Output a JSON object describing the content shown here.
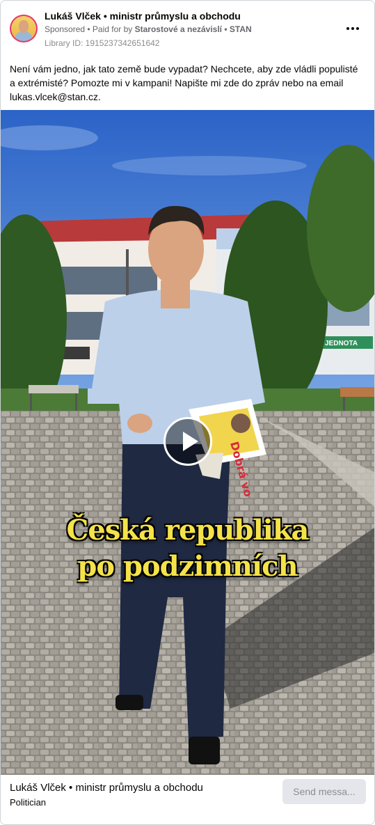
{
  "header": {
    "page_name": "Lukáš Vlček • ministr průmyslu a obchodu",
    "sponsored_label": "Sponsored",
    "paid_for_prefix": " • Paid for by ",
    "paid_for_entity": "Starostové a nezávislí • STAN",
    "library_id": "Library ID: 1915237342651642",
    "more_icon": "more-horizontal-icon"
  },
  "post": {
    "text": "Není vám jedno, jak tato země bude vypadat? Nechcete, aby zde vládli populisté a extrémisté? Pomozte mi v kampani! Napište mi zde do zpráv nebo na email lukas.vlcek@stan.cz."
  },
  "video": {
    "caption_line1": "Česká republika",
    "caption_line2": "po podzimních",
    "play_icon": "play-icon",
    "newspaper_headline": "Dobrá vo",
    "shop_sign": "JEDNOTA"
  },
  "footer": {
    "title": "Lukáš Vlček • ministr průmyslu a obchodu",
    "category": "Politician",
    "send_button": "Send messa..."
  },
  "colors": {
    "caption": "#f4e24a",
    "avatar_ring": "#e8336e",
    "button_bg": "#e4e6eb"
  }
}
